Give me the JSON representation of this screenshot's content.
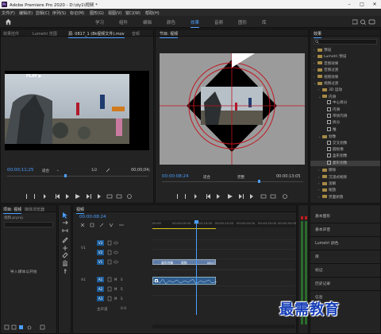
{
  "app": {
    "title": "Adobe Premiere Pro 2020 - D:\\dy1\\视频 *",
    "logo_text": "Pr"
  },
  "menu": [
    "文件(F)",
    "编辑(E)",
    "剪辑(C)",
    "序列(S)",
    "标记(M)",
    "图形(G)",
    "视图(V)",
    "窗口(W)",
    "帮助(H)"
  ],
  "workspaces": [
    "学习",
    "组件",
    "编辑",
    "颜色",
    "效果",
    "音频",
    "图形",
    "库"
  ],
  "active_workspace": "效果",
  "source_panel": {
    "tabs": [
      "效果控件",
      "Lumetri 范围",
      "源: 0817_1 (8k视频文件).mov",
      "音频"
    ],
    "watermark_text": "PLAY ▶",
    "timecode": "00;00;11;25",
    "fit": "适合",
    "ratio": "1/2",
    "end_time": "00;00;04;"
  },
  "program_panel": {
    "tabs": [
      "节目: 视频"
    ],
    "timecode": "00:00:08:24",
    "fit": "适合",
    "quality": "完整",
    "end_time": "00:00:13:05"
  },
  "effects_panel": {
    "tab": "效果",
    "search_placeholder": "",
    "items": [
      {
        "label": "预设",
        "level": 0,
        "arrow": "›",
        "type": "folder"
      },
      {
        "label": "Lumetri 预设",
        "level": 0,
        "arrow": "›",
        "type": "folder"
      },
      {
        "label": "音频效果",
        "level": 0,
        "arrow": "›",
        "type": "folder"
      },
      {
        "label": "音频过渡",
        "level": 0,
        "arrow": "›",
        "type": "folder"
      },
      {
        "label": "视频效果",
        "level": 0,
        "arrow": "›",
        "type": "folder"
      },
      {
        "label": "视频过渡",
        "level": 0,
        "arrow": "⌄",
        "type": "folder"
      },
      {
        "label": "3D 运动",
        "level": 1,
        "arrow": "›",
        "type": "folder"
      },
      {
        "label": "内滑",
        "level": 1,
        "arrow": "⌄",
        "type": "folder"
      },
      {
        "label": "中心拆分",
        "level": 2,
        "arrow": "",
        "type": "fx"
      },
      {
        "label": "内滑",
        "level": 2,
        "arrow": "",
        "type": "fx"
      },
      {
        "label": "带状内滑",
        "level": 2,
        "arrow": "",
        "type": "fx"
      },
      {
        "label": "拆分",
        "level": 2,
        "arrow": "",
        "type": "fx"
      },
      {
        "label": "推",
        "level": 2,
        "arrow": "",
        "type": "fx"
      },
      {
        "label": "划像",
        "level": 1,
        "arrow": "⌄",
        "type": "folder"
      },
      {
        "label": "交叉划像",
        "level": 2,
        "arrow": "",
        "type": "fx"
      },
      {
        "label": "圆划像",
        "level": 2,
        "arrow": "",
        "type": "fx"
      },
      {
        "label": "盒形划像",
        "level": 2,
        "arrow": "",
        "type": "fx"
      },
      {
        "label": "菱形划像",
        "level": 2,
        "arrow": "",
        "type": "fx",
        "highlight": true
      },
      {
        "label": "擦除",
        "level": 1,
        "arrow": "›",
        "type": "folder"
      },
      {
        "label": "沉浸式视频",
        "level": 1,
        "arrow": "›",
        "type": "folder"
      },
      {
        "label": "溶解",
        "level": 1,
        "arrow": "›",
        "type": "folder"
      },
      {
        "label": "缩放",
        "level": 1,
        "arrow": "›",
        "type": "folder"
      },
      {
        "label": "页面剥落",
        "level": 1,
        "arrow": "›",
        "type": "folder"
      }
    ],
    "bottom_sections": [
      "基本图形",
      "基本声音",
      "Lumetri 颜色",
      "库",
      "标记",
      "历史记录",
      "信息"
    ]
  },
  "project_panel": {
    "tabs": [
      "项目: 视频",
      "媒体浏览器"
    ],
    "path": "视频.prproj",
    "import_text": "导入媒体以开始"
  },
  "timeline": {
    "tab": "视频",
    "timecode": "00:00:08:24",
    "ruler": [
      "00:00",
      "00:00:05:00",
      "00:00:10:00",
      "00:00:15:00",
      "00:00:20:00",
      "00:00:25:00",
      "00:00:30:00"
    ],
    "video_tracks": [
      "V3",
      "V2",
      "V1"
    ],
    "audio_tracks": [
      "A1",
      "A2",
      "A3"
    ],
    "master_label": "主声道",
    "master_value": "0.0",
    "clip_v1_label": "视频",
    "clip_v1_sub": "0817",
    "clip_title": "盒形划像",
    "clip_a1_label": "",
    "v1_source": "V1",
    "a1_source": "A1"
  },
  "watermark_text": "最需教育",
  "colors": {
    "accent": "#4a9eff",
    "timecode": "#4a9eff",
    "playhead": "#4a9eff",
    "track_target": "#1b5d9c",
    "watermark": "#1840b8"
  }
}
